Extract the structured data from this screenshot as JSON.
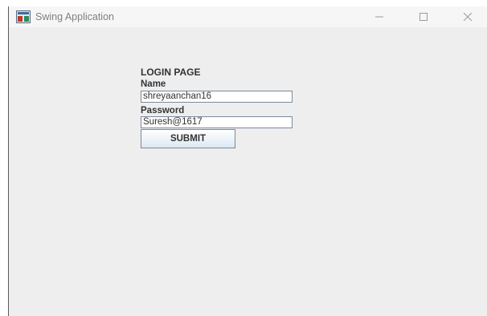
{
  "window": {
    "title": "Swing Application",
    "icon": "java-app-icon",
    "controls": [
      "minimize-icon",
      "maximize-icon",
      "close-icon"
    ]
  },
  "form": {
    "heading": "LOGIN PAGE",
    "name_label": "Name",
    "name_value": "shreyaanchan16",
    "password_label": "Password",
    "password_value": "Suresh@1617",
    "submit_label": "SUBMIT"
  },
  "colors": {
    "window_bg": "#eeeeee",
    "titlebar_bg": "#f6f6f6",
    "field_border": "#7a8a99",
    "button_gradient_bottom": "#dde8f3"
  }
}
